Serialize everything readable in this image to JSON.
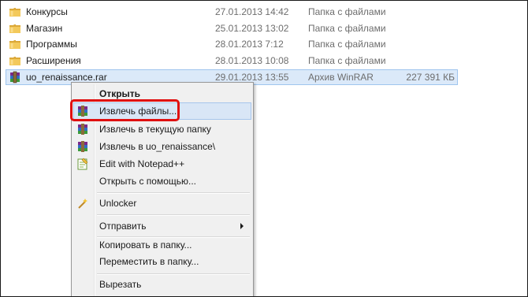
{
  "files": [
    {
      "name": "Конкурсы",
      "date": "27.01.2013 14:42",
      "type": "Папка с файлами",
      "size": "",
      "icon": "folder-icon"
    },
    {
      "name": "Магазин",
      "date": "25.01.2013 13:02",
      "type": "Папка с файлами",
      "size": "",
      "icon": "folder-icon"
    },
    {
      "name": "Программы",
      "date": "28.01.2013 7:12",
      "type": "Папка с файлами",
      "size": "",
      "icon": "folder-icon"
    },
    {
      "name": "Расширения",
      "date": "28.01.2013 10:08",
      "type": "Папка с файлами",
      "size": "",
      "icon": "folder-icon"
    },
    {
      "name": "uo_renaissance.rar",
      "date": "29.01.2013 13:55",
      "type": "Архив WinRAR",
      "size": "227 391 КБ",
      "icon": "winrar-archive-icon"
    }
  ],
  "context_menu": {
    "open": "Открыть",
    "extract_files": "Извлечь файлы...",
    "extract_here": "Извлечь в текущую папку",
    "extract_to": "Извлечь в uo_renaissance\\",
    "edit_notepad": "Edit with Notepad++",
    "open_with": "Открыть с помощью...",
    "unlocker": "Unlocker",
    "send_to": "Отправить",
    "copy_to": "Копировать в папку...",
    "move_to": "Переместить в папку...",
    "cut": "Вырезать"
  },
  "colors": {
    "selection": "#dbe9f9",
    "highlight_box": "#e01010",
    "folder": "#e8b84a"
  }
}
